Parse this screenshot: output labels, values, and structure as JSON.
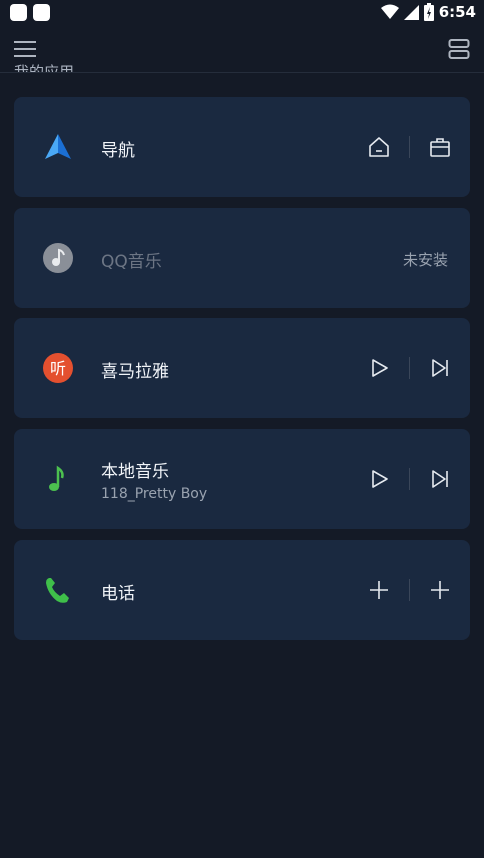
{
  "status_bar": {
    "time": "6:54"
  },
  "section": {
    "title": "我的应用"
  },
  "cards": [
    {
      "name": "导航",
      "icon": "navigation-arrow-icon",
      "actions": [
        "home-icon",
        "briefcase-icon"
      ]
    },
    {
      "name": "QQ音乐",
      "icon": "qq-music-icon",
      "status": "未安装"
    },
    {
      "name": "喜马拉雅",
      "icon": "ximalaya-icon",
      "icon_text": "听",
      "actions": [
        "play-icon",
        "next-track-icon"
      ]
    },
    {
      "name": "本地音乐",
      "subtitle": "118_Pretty Boy",
      "icon": "music-note-icon",
      "actions": [
        "play-icon",
        "next-track-icon"
      ]
    },
    {
      "name": "电话",
      "icon": "phone-icon",
      "actions": [
        "plus-icon",
        "plus-icon"
      ]
    }
  ],
  "colors": {
    "background": "#141a26",
    "card": "#1a2940",
    "accent_blue": "#2f8fe8",
    "ximalaya_red": "#e4502f",
    "green": "#3fbf4a"
  }
}
